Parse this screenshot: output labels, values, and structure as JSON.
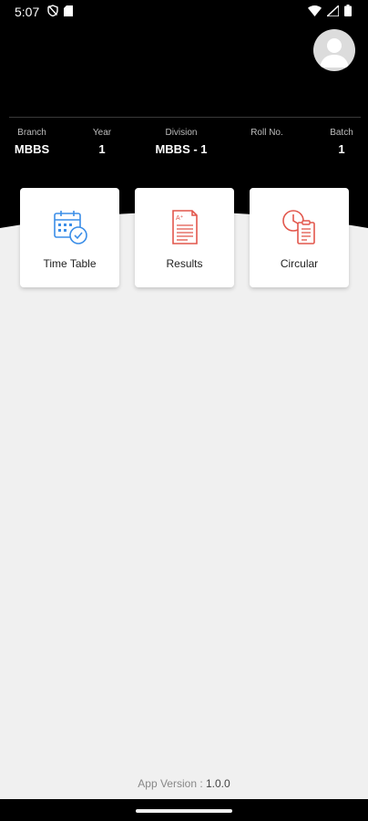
{
  "status_bar": {
    "time": "5:07",
    "icons_left": [
      "shield-off-icon",
      "sd-card-icon"
    ],
    "icons_right": [
      "wifi-icon",
      "signal-icon",
      "battery-icon"
    ]
  },
  "profile": {
    "avatar_icon": "user-avatar-icon"
  },
  "student_info": [
    {
      "label": "Branch",
      "value": "MBBS"
    },
    {
      "label": "Year",
      "value": "1"
    },
    {
      "label": "Division",
      "value": "MBBS - 1"
    },
    {
      "label": "Roll No.",
      "value": ""
    },
    {
      "label": "Batch",
      "value": "1"
    }
  ],
  "cards": [
    {
      "label": "Time Table",
      "icon": "calendar-clock-icon",
      "color": "#3b8ee8"
    },
    {
      "label": "Results",
      "icon": "document-grade-icon",
      "color": "#e2574c"
    },
    {
      "label": "Circular",
      "icon": "clock-document-icon",
      "color": "#e2574c"
    }
  ],
  "footer": {
    "version_label": "App Version : ",
    "version_number": "1.0.0"
  },
  "colors": {
    "header_bg": "#000000",
    "page_bg": "#f0f0f0",
    "accent_blue": "#3b8ee8",
    "accent_red": "#e2574c"
  }
}
